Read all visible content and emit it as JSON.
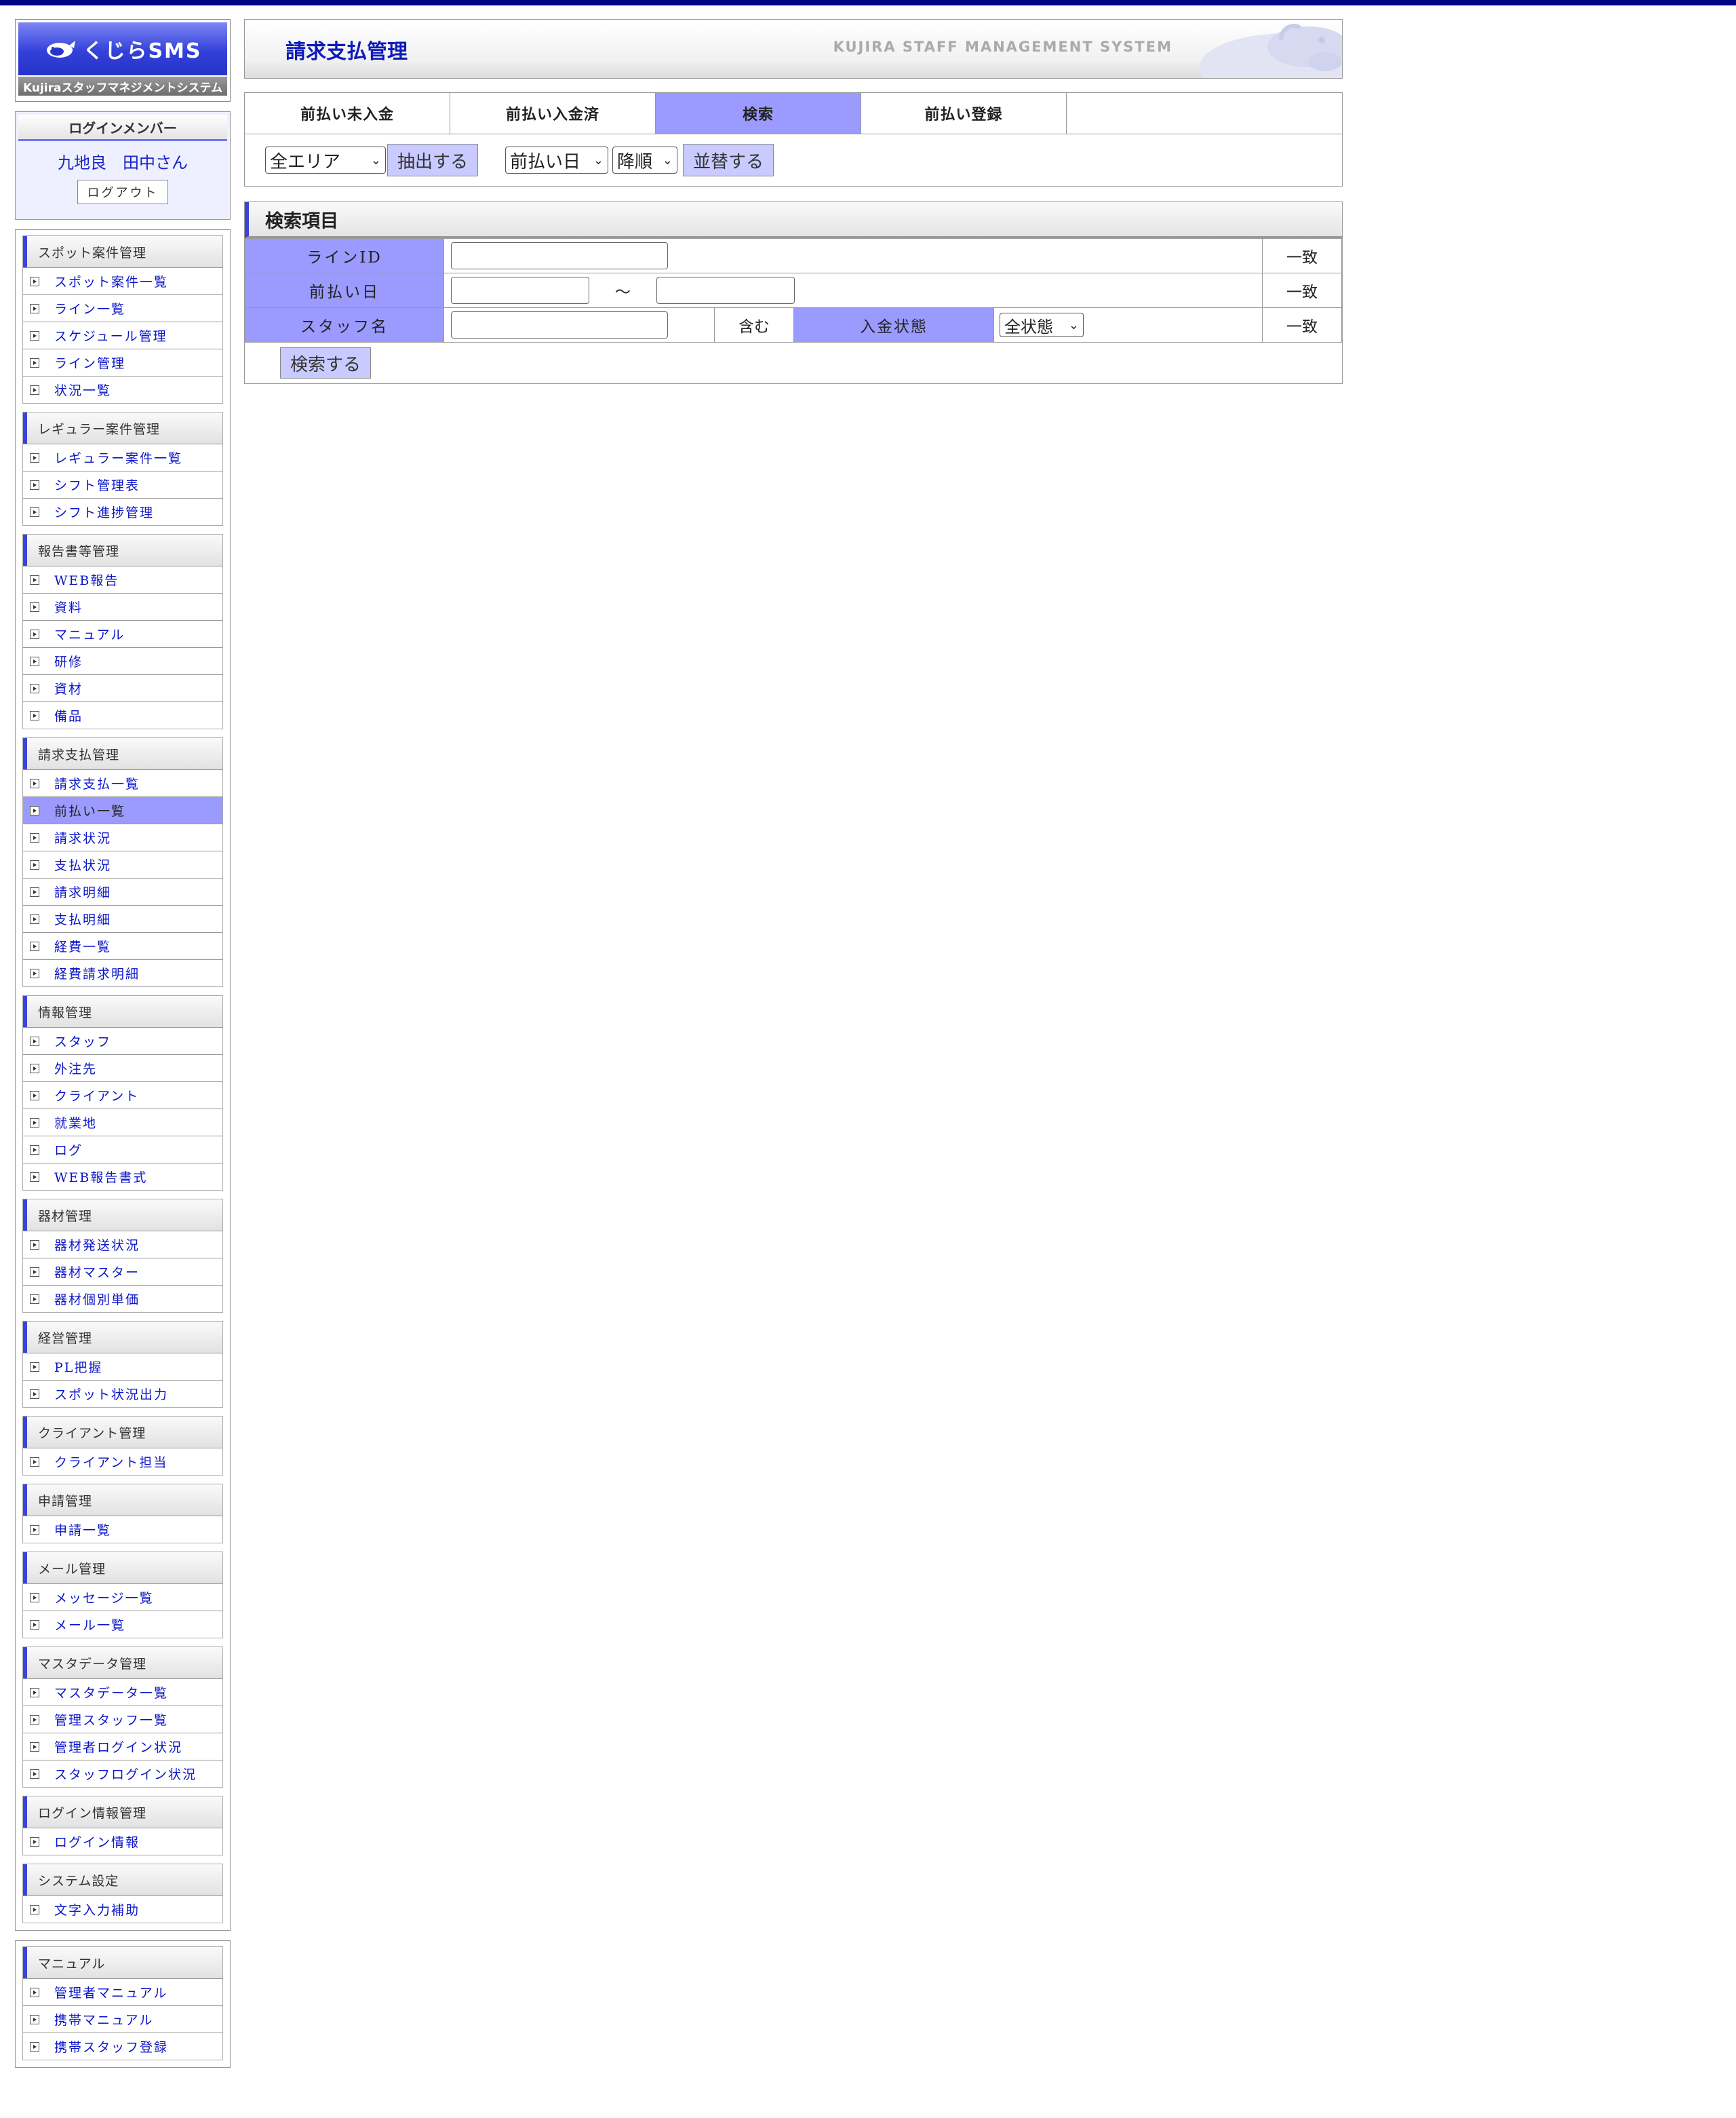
{
  "app": {
    "logo_text": "くじらSMS",
    "logo_subtitle": "Kujiraスタッフマネジメントシステム",
    "brand_text": "KUJIRA STAFF MANAGEMENT SYSTEM",
    "accent_color": "#9b9bff",
    "link_color": "#0c16c8"
  },
  "login": {
    "heading": "ログインメンバー",
    "user_name": "九地良　田中さん",
    "logout_label": "ログアウト"
  },
  "sidebar": {
    "panels": [
      {
        "sections": [
          {
            "title": "スポット案件管理",
            "items": [
              "スポット案件一覧",
              "ライン一覧",
              "スケジュール管理",
              "ライン管理",
              "状況一覧"
            ]
          },
          {
            "title": "レギュラー案件管理",
            "items": [
              "レギュラー案件一覧",
              "シフト管理表",
              "シフト進捗管理"
            ]
          },
          {
            "title": "報告書等管理",
            "items": [
              "WEB報告",
              "資料",
              "マニュアル",
              "研修",
              "資材",
              "備品"
            ]
          },
          {
            "title": "請求支払管理",
            "items": [
              "請求支払一覧",
              "前払い一覧",
              "請求状況",
              "支払状況",
              "請求明細",
              "支払明細",
              "経費一覧",
              "経費請求明細"
            ]
          },
          {
            "title": "情報管理",
            "items": [
              "スタッフ",
              "外注先",
              "クライアント",
              "就業地",
              "ログ",
              "WEB報告書式"
            ]
          },
          {
            "title": "器材管理",
            "items": [
              "器材発送状況",
              "器材マスター",
              "器材個別単価"
            ]
          },
          {
            "title": "経営管理",
            "items": [
              "PL把握",
              "スポット状況出力"
            ]
          },
          {
            "title": "クライアント管理",
            "items": [
              "クライアント担当"
            ]
          },
          {
            "title": "申請管理",
            "items": [
              "申請一覧"
            ]
          },
          {
            "title": "メール管理",
            "items": [
              "メッセージ一覧",
              "メール一覧"
            ]
          },
          {
            "title": "マスタデータ管理",
            "items": [
              "マスタデータ一覧",
              "管理スタッフ一覧",
              "管理者ログイン状況",
              "スタッフログイン状況"
            ]
          },
          {
            "title": "ログイン情報管理",
            "items": [
              "ログイン情報"
            ]
          },
          {
            "title": "システム設定",
            "items": [
              "文字入力補助"
            ]
          }
        ]
      },
      {
        "sections": [
          {
            "title": "マニュアル",
            "items": [
              "管理者マニュアル",
              "携帯マニュアル",
              "携帯スタッフ登録"
            ]
          }
        ]
      }
    ],
    "active_item": "前払い一覧"
  },
  "header": {
    "title": "請求支払管理"
  },
  "tabs": [
    {
      "label": "前払い未入金",
      "active": false
    },
    {
      "label": "前払い入金済",
      "active": false
    },
    {
      "label": "検索",
      "active": true
    },
    {
      "label": "前払い登録",
      "active": false
    }
  ],
  "filters": {
    "area_select": "全エリア",
    "extract_button": "抽出する",
    "sort_field_select": "前払い日",
    "sort_order_select": "降順",
    "sort_button": "並替する"
  },
  "search": {
    "title": "検索項目",
    "line_id_label": "ラインID",
    "line_id_value": "",
    "line_id_match": "一致",
    "prepay_date_label": "前払い日",
    "date_from": "",
    "date_to": "",
    "date_separator": "〜",
    "prepay_date_match": "一致",
    "staff_name_label": "スタッフ名",
    "staff_name_value": "",
    "staff_name_mode": "含む",
    "payment_status_label": "入金状態",
    "payment_status_select": "全状態",
    "payment_status_match": "一致",
    "search_button": "検索する"
  }
}
